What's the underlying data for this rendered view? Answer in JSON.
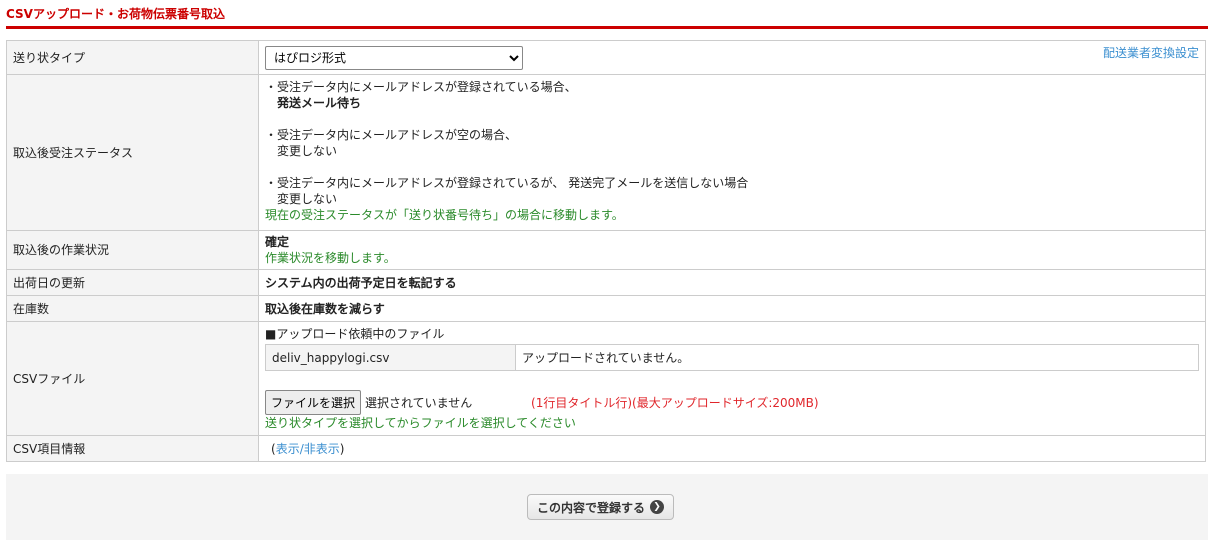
{
  "title": "CSVアップロード・お荷物伝票番号取込",
  "rows": {
    "invoice_type": {
      "label": "送り状タイプ",
      "selected": "はぴロジ形式",
      "link": "配送業者変換設定"
    },
    "status": {
      "label": "取込後受注ステータス",
      "items": [
        {
          "cond": "・受注データ内にメールアドレスが登録されている場合、",
          "result": "発送メール待ち"
        },
        {
          "cond": "・受注データ内にメールアドレスが空の場合、",
          "result": "変更しない"
        },
        {
          "cond": "・受注データ内にメールアドレスが登録されているが、 発送完了メールを送信しない場合",
          "result": "変更しない"
        }
      ],
      "note": "現在の受注ステータスが「送り状番号待ち」の場合に移動します。"
    },
    "work": {
      "label": "取込後の作業状況",
      "value": "確定",
      "note": "作業状況を移動します。"
    },
    "ship_date": {
      "label": "出荷日の更新",
      "value": "システム内の出荷予定日を転記する"
    },
    "stock": {
      "label": "在庫数",
      "value": "取込後在庫数を減らす"
    },
    "csv": {
      "label": "CSVファイル",
      "pending_heading": "■アップロード依頼中のファイル",
      "file_name": "deliv_happylogi.csv",
      "file_status": "アップロードされていません。",
      "choose_button": "ファイルを選択",
      "no_file": "選択されていません",
      "hint_red": "(1行目タイトル行)(最大アップロードサイズ:200MB)",
      "hint_green": "送り状タイプを選択してからファイルを選択してください"
    },
    "csv_info": {
      "label": "CSV項目情報",
      "open": "(",
      "toggle": "表示/非表示",
      "close": ")"
    }
  },
  "submit_label": "この内容で登録する"
}
